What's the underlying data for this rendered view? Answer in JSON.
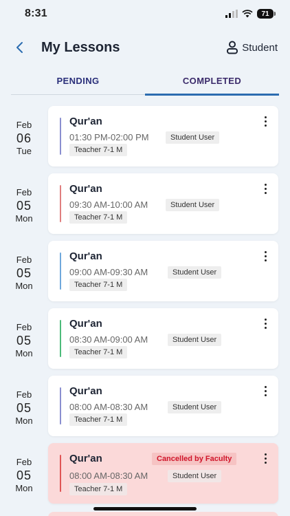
{
  "status_bar": {
    "time": "8:31",
    "battery": "71"
  },
  "header": {
    "title": "My Lessons",
    "role": "Student"
  },
  "tabs": [
    {
      "label": "PENDING"
    },
    {
      "label": "COMPLETED"
    }
  ],
  "lessons": [
    {
      "date": {
        "month": "Feb",
        "day": "06",
        "weekday": "Tue"
      },
      "subject": "Qur'an",
      "time": "01:30 PM-02:00 PM",
      "student": "Student User",
      "teacher": "Teacher 7-1 M",
      "accent": "#8a8fd0"
    },
    {
      "date": {
        "month": "Feb",
        "day": "05",
        "weekday": "Mon"
      },
      "subject": "Qur'an",
      "time": "09:30 AM-10:00 AM",
      "student": "Student User",
      "teacher": "Teacher 7-1 M",
      "accent": "#e07f7f"
    },
    {
      "date": {
        "month": "Feb",
        "day": "05",
        "weekday": "Mon"
      },
      "subject": "Qur'an",
      "time": "09:00 AM-09:30 AM",
      "student": "Student User",
      "teacher": "Teacher 7-1 M",
      "accent": "#6fa8dc"
    },
    {
      "date": {
        "month": "Feb",
        "day": "05",
        "weekday": "Mon"
      },
      "subject": "Qur'an",
      "time": "08:30 AM-09:00 AM",
      "student": "Student User",
      "teacher": "Teacher 7-1 M",
      "accent": "#4cbb7a"
    },
    {
      "date": {
        "month": "Feb",
        "day": "05",
        "weekday": "Mon"
      },
      "subject": "Qur'an",
      "time": "08:00 AM-08:30 AM",
      "student": "Student User",
      "teacher": "Teacher 7-1 M",
      "accent": "#8a8fd0"
    },
    {
      "date": {
        "month": "Feb",
        "day": "05",
        "weekday": "Mon"
      },
      "subject": "Qur'an",
      "time": "08:00 AM-08:30 AM",
      "student": "Student User",
      "teacher": "Teacher 7-1 M",
      "accent": "#e05555",
      "status": "Cancelled by Faculty"
    }
  ]
}
